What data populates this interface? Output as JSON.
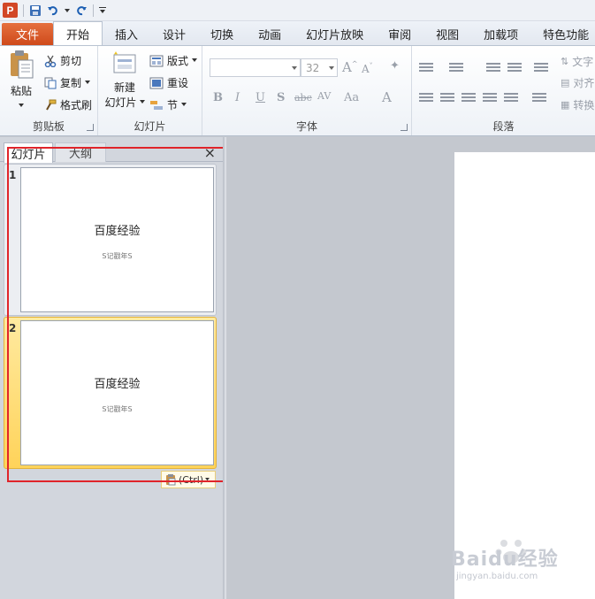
{
  "app": {
    "icon_letter": "P"
  },
  "tabs": [
    "文件",
    "开始",
    "插入",
    "设计",
    "切换",
    "动画",
    "幻灯片放映",
    "审阅",
    "视图",
    "加载项",
    "特色功能"
  ],
  "ribbon": {
    "clipboard": {
      "paste": "粘贴",
      "cut": "剪切",
      "copy": "复制",
      "format_painter": "格式刷",
      "label": "剪贴板"
    },
    "slides": {
      "new_slide_line1": "新建",
      "new_slide_line2": "幻灯片",
      "layout": "版式",
      "reset": "重设",
      "section": "节",
      "label": "幻灯片"
    },
    "font": {
      "size_value": "32",
      "label": "字体"
    },
    "paragraph": {
      "text_direction": "文字",
      "align": "对齐",
      "convert": "转换",
      "label": "段落"
    }
  },
  "panel": {
    "tab_slides": "幻灯片",
    "tab_outline": "大纲",
    "close": "×",
    "slides": [
      {
        "number": "1",
        "title": "百度经验",
        "subtitle": "S记戳年S"
      },
      {
        "number": "2",
        "title": "百度经验",
        "subtitle": "S记戳年S"
      }
    ],
    "paste_tag": "(Ctrl)"
  },
  "watermark": {
    "text": "Baidu经验",
    "url": "jingyan.baidu.com"
  }
}
